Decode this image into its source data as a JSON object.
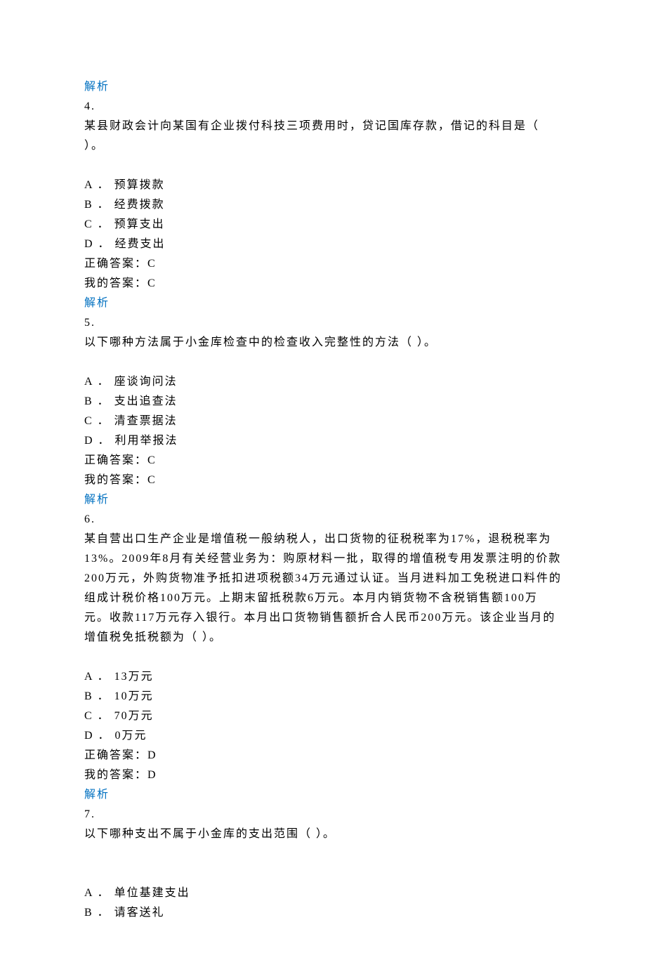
{
  "q3": {
    "analysis": "解析"
  },
  "q4": {
    "num": "4.",
    "stem": "某县财政会计向某国有企业拨付科技三项费用时，贷记国库存款，借记的科目是（ ）。",
    "optA": "A ． 预算拨款",
    "optB": "B ． 经费拨款",
    "optC": "C ． 预算支出",
    "optD": "D ． 经费支出",
    "correct": "正确答案：C",
    "mine": "我的答案：C",
    "analysis": "解析"
  },
  "q5": {
    "num": "5.",
    "stem": "以下哪种方法属于小金库检查中的检查收入完整性的方法（ ）。",
    "optA": "A ． 座谈询问法",
    "optB": "B ． 支出追查法",
    "optC": "C ． 清查票据法",
    "optD": "D ． 利用举报法",
    "correct": "正确答案：C",
    "mine": "我的答案：C",
    "analysis": "解析"
  },
  "q6": {
    "num": "6.",
    "stem": "某自营出口生产企业是增值税一般纳税人，出口货物的征税税率为17%，退税税率为13%。2009年8月有关经营业务为：购原材料一批，取得的增值税专用发票注明的价款200万元，外购货物准予抵扣进项税额34万元通过认证。当月进料加工免税进口料件的组成计税价格100万元。上期末留抵税款6万元。本月内销货物不含税销售额100万元。收款117万元存入银行。本月出口货物销售额折合人民币200万元。该企业当月的增值税免抵税额为（  ）。",
    "optA": "A ． 13万元",
    "optB": "B ． 10万元",
    "optC": "C ． 70万元",
    "optD": "D ． 0万元",
    "correct": "正确答案：D",
    "mine": "我的答案：D",
    "analysis": "解析"
  },
  "q7": {
    "num": "7.",
    "stem": "以下哪种支出不属于小金库的支出范围（ ）。",
    "optA": "A ． 单位基建支出",
    "optB": "B ． 请客送礼"
  }
}
